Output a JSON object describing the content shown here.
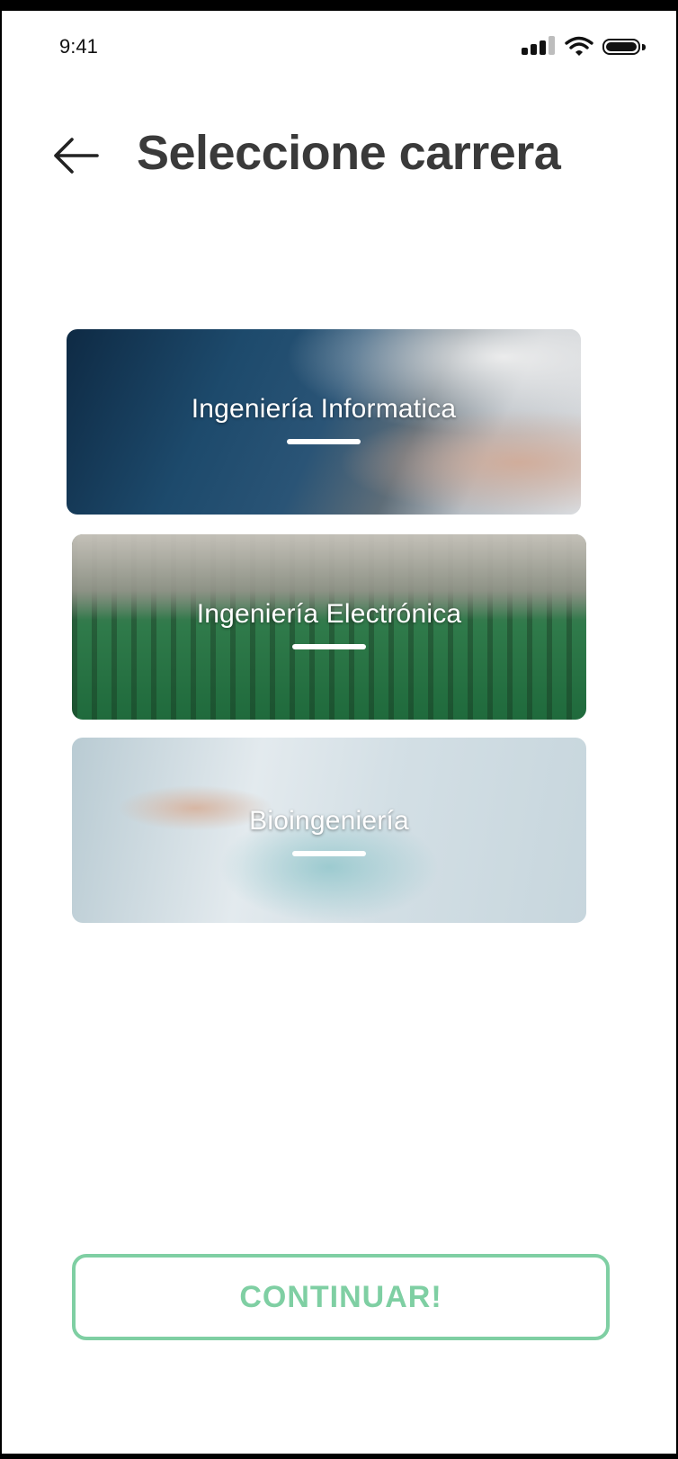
{
  "status_bar": {
    "time": "9:41",
    "icons": [
      "signal-icon",
      "wifi-icon",
      "battery-icon"
    ]
  },
  "header": {
    "back_icon": "arrow-left-icon",
    "title": "Seleccione carrera"
  },
  "careers": [
    {
      "label": "Ingeniería Informatica"
    },
    {
      "label": "Ingeniería Electrónica"
    },
    {
      "label": "Bioingeniería"
    }
  ],
  "actions": {
    "continue_label": "CONTINUAR!"
  },
  "colors": {
    "title": "#3a3a3a",
    "accent_green": "#7fcfa3",
    "background": "#ffffff"
  }
}
